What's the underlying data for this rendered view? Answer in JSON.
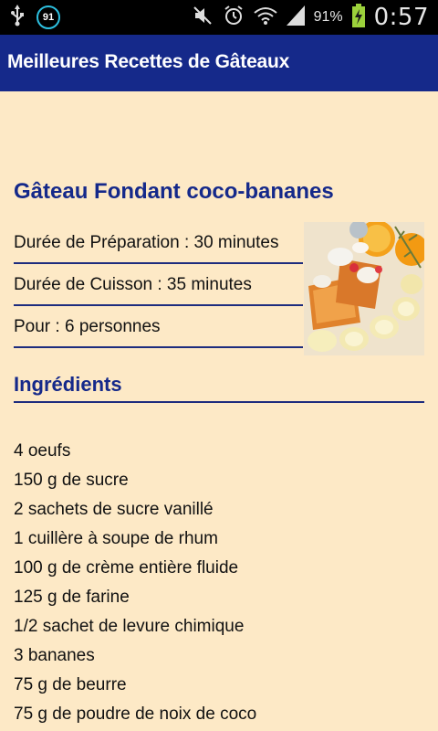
{
  "status_bar": {
    "badge": "91",
    "battery_percent": "91%",
    "time": "0:57",
    "icons": [
      "usb-icon",
      "notification-91-icon",
      "mute-icon",
      "alarm-icon",
      "wifi-icon",
      "signal-icon",
      "battery-charging-icon"
    ]
  },
  "app_bar": {
    "title": "Meilleures Recettes de Gâteaux",
    "color": "#15298A"
  },
  "recipe": {
    "title": "Gâteau Fondant coco-bananes",
    "prep_time": "Durée de Préparation : 30 minutes",
    "cook_time": "Durée de Cuisson : 35 minutes",
    "servings": "Pour : 6 personnes"
  },
  "ingredients_section": {
    "title": "Ingrédients",
    "items": [
      "4 oeufs",
      "150 g de sucre",
      "2 sachets de sucre vanillé",
      "1 cuillère à soupe de rhum",
      "100 g de crème entière fluide",
      "125 g de farine",
      "1/2 sachet de levure chimique",
      "3 bananes",
      "75 g de beurre",
      "75 g de poudre de noix de coco"
    ]
  },
  "colors": {
    "background": "#FDE9C6",
    "accent": "#15298A"
  }
}
